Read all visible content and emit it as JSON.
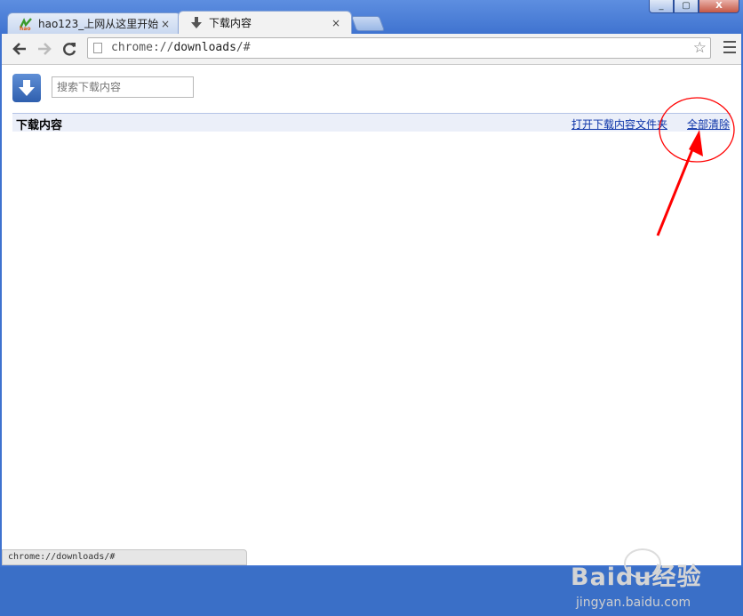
{
  "window": {
    "controls": {
      "minimize": "_",
      "restore": "▢",
      "close": "X"
    }
  },
  "tabs": [
    {
      "label": "hao123_上网从这里开始",
      "close": "×",
      "favicon": "hao-logo-icon"
    },
    {
      "label": "下载内容",
      "close": "×",
      "favicon": "download-arrow-icon"
    }
  ],
  "toolbar": {
    "url_scheme": "chrome://",
    "url_host": "downloads",
    "url_rest": "/#"
  },
  "downloads": {
    "search_placeholder": "搜索下载内容",
    "header_title": "下载内容",
    "open_folder_link": "打开下载内容文件夹",
    "clear_all_link": "全部清除"
  },
  "status": {
    "text": "chrome://downloads/#"
  },
  "watermark": {
    "brand": "Baidu经验",
    "domain": "jingyan.baidu.com"
  },
  "colors": {
    "window_frame": "#3e72cf",
    "link": "#0b33a8",
    "annotation": "#ff0000"
  }
}
